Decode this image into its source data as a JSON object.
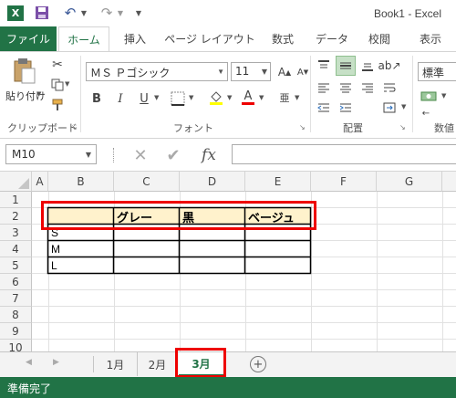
{
  "titlebar": {
    "app_icon": "X",
    "title": "Book1 - Excel"
  },
  "tabs": {
    "file": "ファイル",
    "home": "ホーム",
    "insert": "挿入",
    "page_layout": "ページ レイアウト",
    "formulas": "数式",
    "data": "データ",
    "review": "校閲",
    "view": "表示"
  },
  "ribbon": {
    "paste_label": "貼り付け",
    "clipboard_group": "クリップボード",
    "font_name": "ＭＳ Ｐゴシック",
    "font_size": "11",
    "font_group": "フォント",
    "bold": "B",
    "italic": "I",
    "underline": "U",
    "font_color_glyph": "A",
    "alignment_group": "配置",
    "number_format": "標準",
    "number_group": "数値"
  },
  "formula_bar": {
    "name_box": "M10",
    "fx": "fx",
    "content": ""
  },
  "columns": [
    "A",
    "B",
    "C",
    "D",
    "E",
    "F",
    "G"
  ],
  "rows": [
    "1",
    "2",
    "3",
    "4",
    "5",
    "6",
    "7",
    "8",
    "9",
    "10"
  ],
  "table": {
    "headers": [
      "グレー",
      "黒",
      "ベージュ"
    ],
    "row_labels": [
      "S",
      "M",
      "L"
    ]
  },
  "sheets": [
    "1月",
    "2月",
    "3月"
  ],
  "active_sheet": "3月",
  "status": "準備完了",
  "colors": {
    "excel_green": "#217346",
    "highlight_red": "#e00000",
    "header_fill": "#fff2cc"
  }
}
